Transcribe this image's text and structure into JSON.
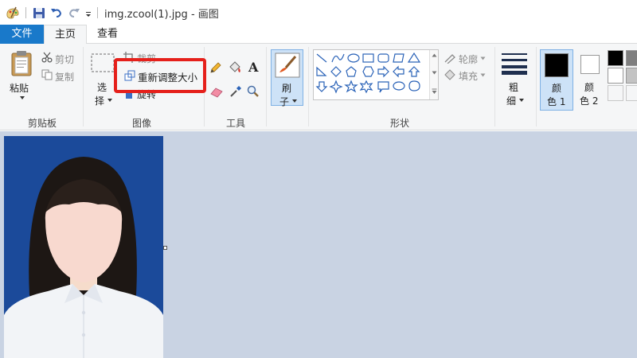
{
  "window": {
    "title": "img.zcool(1).jpg - 画图"
  },
  "tabs": {
    "file": "文件",
    "home": "主页",
    "view": "查看"
  },
  "clipboard": {
    "paste": "粘贴",
    "cut": "剪切",
    "copy": "复制",
    "group": "剪贴板"
  },
  "image": {
    "select_1": "选",
    "select_2": "择",
    "crop": "裁剪",
    "resize": "重新调整大小",
    "rotate": "旋转",
    "group": "图像"
  },
  "tools": {
    "group": "工具"
  },
  "brush": {
    "label_1": "刷",
    "label_2": "子"
  },
  "shapes": {
    "outline": "轮廓",
    "fill": "填充",
    "group": "形状"
  },
  "size": {
    "label_1": "粗",
    "label_2": "细"
  },
  "colors": {
    "color1_a": "颜",
    "color1_b": "色 1",
    "color2_a": "颜",
    "color2_b": "色 2",
    "color1_value": "#000000",
    "color2_value": "#ffffff",
    "palette": [
      "#000000",
      "#7f7f7f",
      "#ffffff",
      "#c3c3c3",
      "#ffffff",
      "#ffffff"
    ],
    "accent": "#1979ca",
    "highlight": "#e5201b",
    "photo_background": "#1b4a9a"
  }
}
